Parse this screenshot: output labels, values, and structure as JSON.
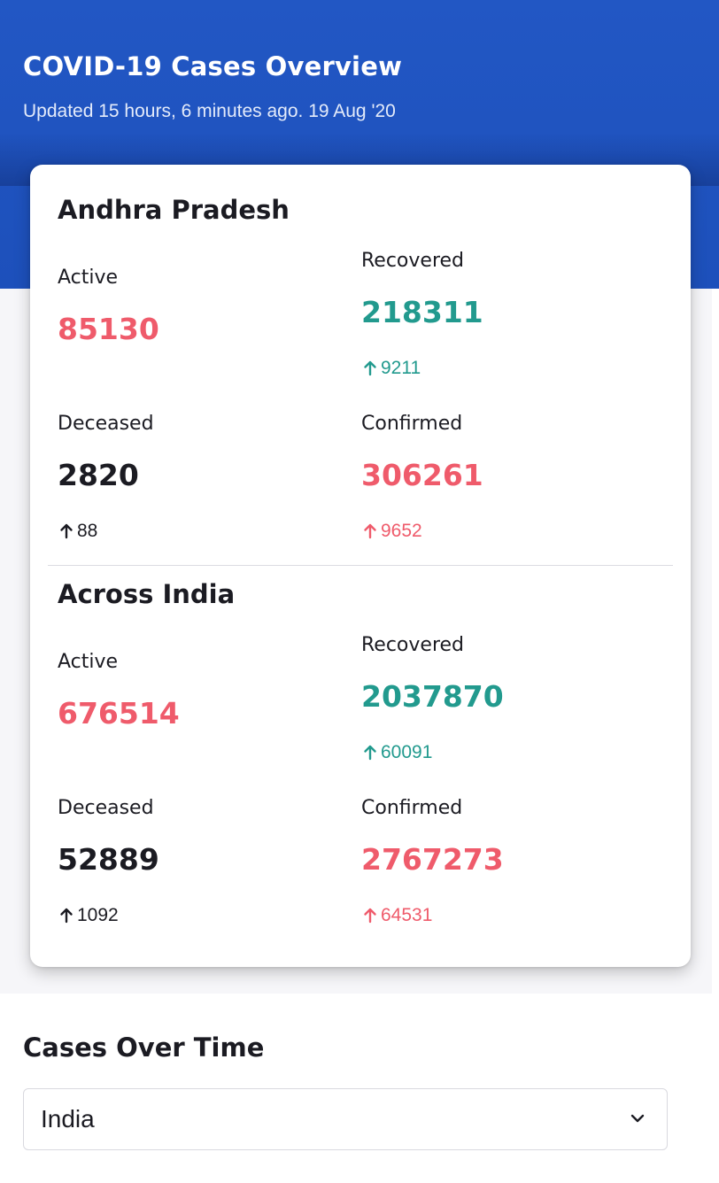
{
  "header": {
    "title": "COVID-19 Cases Overview",
    "updated": "Updated 15 hours, 6 minutes ago. 19 Aug '20"
  },
  "state": {
    "name": "Andhra Pradesh",
    "active_label": "Active",
    "active_value": "85130",
    "recovered_label": "Recovered",
    "recovered_value": "218311",
    "recovered_delta": "9211",
    "deceased_label": "Deceased",
    "deceased_value": "2820",
    "deceased_delta": "88",
    "confirmed_label": "Confirmed",
    "confirmed_value": "306261",
    "confirmed_delta": "9652"
  },
  "india": {
    "name": "Across India",
    "active_label": "Active",
    "active_value": "676514",
    "recovered_label": "Recovered",
    "recovered_value": "2037870",
    "recovered_delta": "60091",
    "deceased_label": "Deceased",
    "deceased_value": "52889",
    "deceased_delta": "1092",
    "confirmed_label": "Confirmed",
    "confirmed_value": "2767273",
    "confirmed_delta": "64531"
  },
  "cases_over_time": {
    "title": "Cases Over Time",
    "selected": "India"
  },
  "colors": {
    "header_blue": "#1d50bb",
    "red": "#ef5b6b",
    "green": "#229a8e",
    "dark": "#1b1b22"
  },
  "icons": {
    "delta": "arrow-up-icon",
    "select": "chevron-down-icon"
  }
}
